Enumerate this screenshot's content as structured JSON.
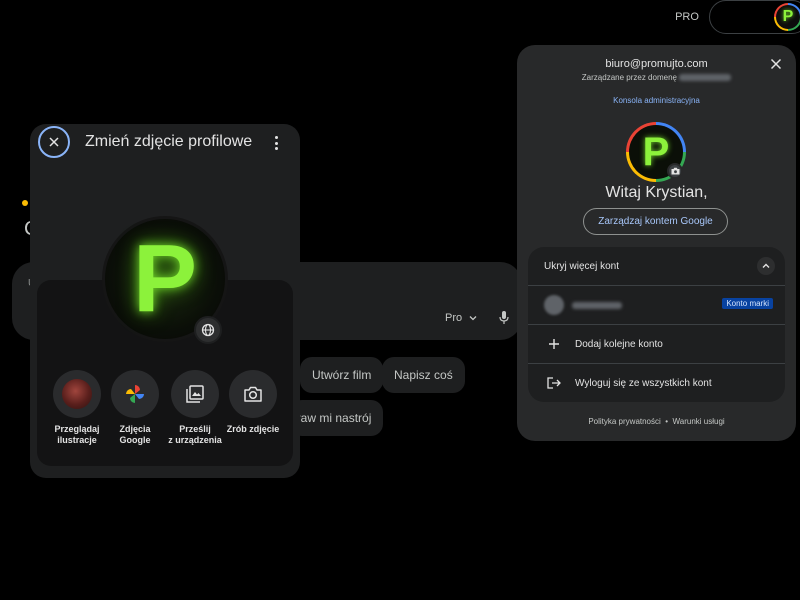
{
  "topbar": {
    "pro_label": "PRO",
    "avatar_letter": "P"
  },
  "background": {
    "input_fragment": "U",
    "heading_fragment": "C",
    "mode_label": "Pro",
    "chips": [
      "Utwórz film",
      "Napisz coś",
      "praw mi nastrój"
    ]
  },
  "photo_dialog": {
    "title": "Zmień zdjęcie profilowe",
    "avatar_letter": "P",
    "options": [
      {
        "label": "Przeglądaj\nilustracje",
        "icon": "illustration-icon"
      },
      {
        "label": "Zdjęcia\nGoogle",
        "icon": "google-photos-icon"
      },
      {
        "label": "Prześlij\nz urządzenia",
        "icon": "upload-photos-icon"
      },
      {
        "label": "Zrób zdjęcie",
        "icon": "camera-icon"
      }
    ]
  },
  "account_panel": {
    "email": "biuro@promujto.com",
    "managed_by": "Zarządzane przez domenę",
    "admin_console": "Konsola administracyjna",
    "avatar_letter": "P",
    "greeting": "Witaj Krystian,",
    "manage_button": "Zarządzaj kontem Google",
    "hide_accounts": "Ukryj więcej kont",
    "account_badge": "Konto marki",
    "add_account": "Dodaj kolejne konto",
    "logout_all": "Wyloguj się ze wszystkich kont",
    "privacy": "Polityka prywatności",
    "separator": "•",
    "terms": "Warunki usługi"
  },
  "colors": {
    "accent_blue": "#8ab4f8",
    "logo_green": "#8cf23b",
    "panel_bg": "#28292a",
    "dialog_bg": "#1e1f20"
  }
}
